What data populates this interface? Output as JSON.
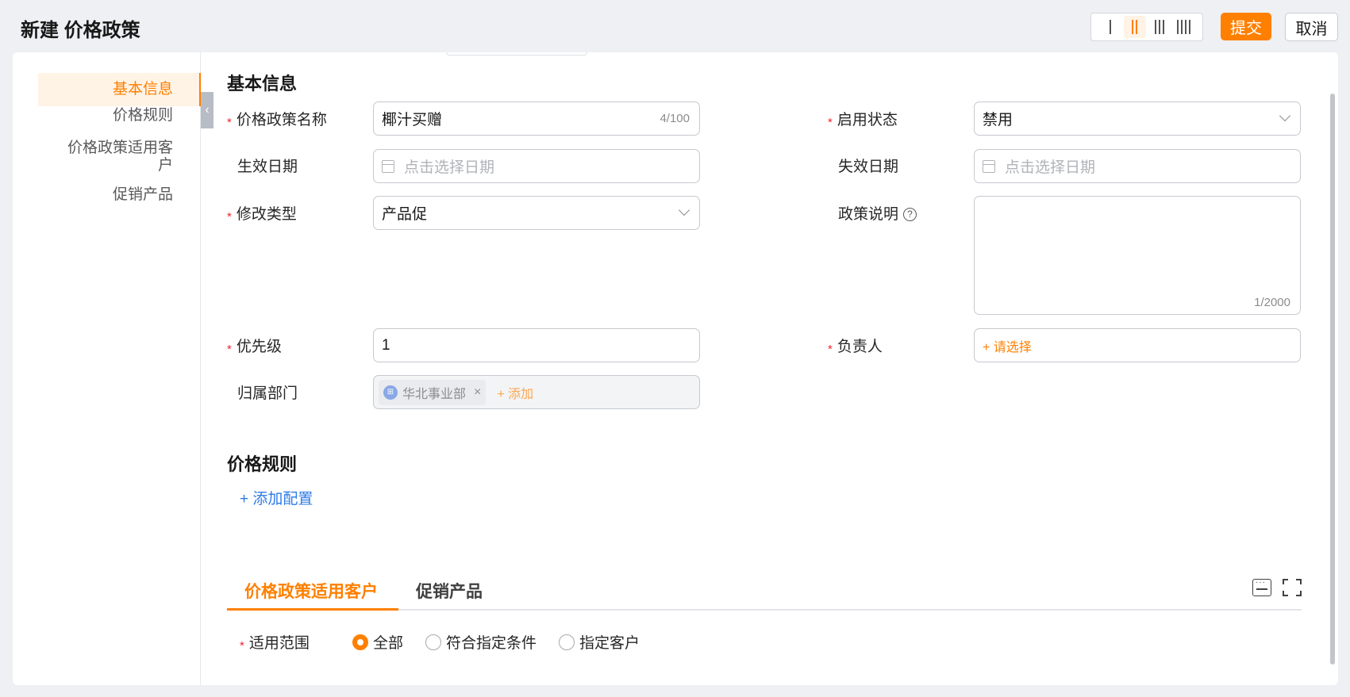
{
  "header": {
    "title": "新建 价格政策",
    "submit_label": "提交",
    "cancel_label": "取消",
    "column_layout_options": [
      "1-column",
      "2-column",
      "3-column",
      "4-column"
    ],
    "column_layout_selected": "2-column"
  },
  "sidebar": {
    "items": [
      {
        "label": "基本信息",
        "active": true
      },
      {
        "label": "价格规则",
        "active": false
      },
      {
        "label": "价格政策适用客户",
        "active": false
      },
      {
        "label": "促销产品",
        "active": false
      }
    ],
    "collapse_icon": "chevron-left-icon"
  },
  "basic_info": {
    "title": "基本信息",
    "policy_name": {
      "label": "价格政策名称",
      "value": "椰汁买赠",
      "counter": "4/100",
      "required": true
    },
    "status": {
      "label": "启用状态",
      "value": "禁用",
      "required": true
    },
    "effective_date": {
      "label": "生效日期",
      "placeholder": "点击选择日期"
    },
    "expiry_date": {
      "label": "失效日期",
      "placeholder": "点击选择日期"
    },
    "modify_type": {
      "label": "修改类型",
      "value": "产品促",
      "required": true
    },
    "description": {
      "label": "政策说明",
      "value": "",
      "counter": "1/2000",
      "help_icon": "question-circle-icon"
    },
    "priority": {
      "label": "优先级",
      "value": "1",
      "required": true
    },
    "owner": {
      "label": "负责人",
      "add_label": "+ 请选择",
      "required": true
    },
    "department": {
      "label": "归属部门",
      "tag": "华北事业部",
      "add_label": "+ 添加"
    }
  },
  "price_rules": {
    "title": "价格规则",
    "add_config_label": "+ 添加配置"
  },
  "tabs": {
    "items": [
      {
        "label": "价格政策适用客户",
        "active": true
      },
      {
        "label": "促销产品",
        "active": false
      }
    ],
    "icons": [
      "keyboard-icon",
      "fullscreen-icon"
    ]
  },
  "scope": {
    "label": "适用范围",
    "required": true,
    "options": [
      {
        "label": "全部",
        "checked": true
      },
      {
        "label": "符合指定条件",
        "checked": false
      },
      {
        "label": "指定客户",
        "checked": false
      }
    ]
  },
  "colors": {
    "accent": "#ff8000",
    "link": "#2e7be6",
    "required": "#f5222d"
  }
}
